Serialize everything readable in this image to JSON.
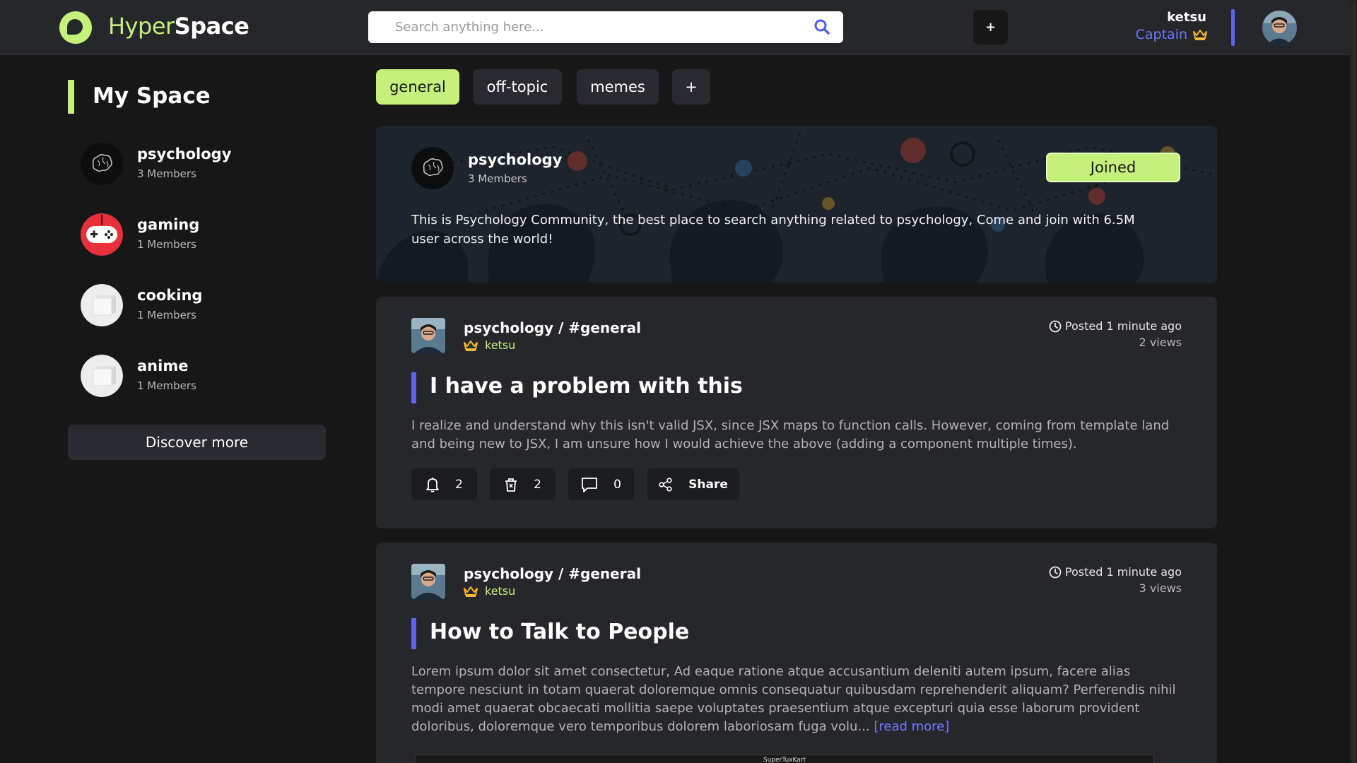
{
  "brand": {
    "part1": "Hyper",
    "part2": "Space"
  },
  "search": {
    "placeholder": "Search anything here..."
  },
  "topbar": {
    "create_label": "+"
  },
  "user": {
    "name": "ketsu",
    "role": "Captain"
  },
  "sidebar": {
    "title": "My Space",
    "items": [
      {
        "name": "psychology",
        "members": "3 Members"
      },
      {
        "name": "gaming",
        "members": "1 Members"
      },
      {
        "name": "cooking",
        "members": "1 Members"
      },
      {
        "name": "anime",
        "members": "1 Members"
      }
    ],
    "discover_label": "Discover more"
  },
  "tabs": [
    {
      "label": "general",
      "active": true
    },
    {
      "label": "off-topic",
      "active": false
    },
    {
      "label": "memes",
      "active": false
    },
    {
      "label": "+",
      "active": false
    }
  ],
  "community": {
    "name": "psychology",
    "members": "3 Members",
    "joined_label": "Joined",
    "description": "This is Psychology Community, the best place to search anything related to psychology, Come and join with 6.5M user across the world!"
  },
  "posts": [
    {
      "path": "psychology / #general",
      "author": "ketsu",
      "posted": "Posted 1 minute ago",
      "views": "2 views",
      "title": "I have a problem with this",
      "body": "I realize and understand why this isn't valid JSX, since JSX maps to function calls. However, coming from template land and being new to JSX, I am unsure how I would achieve the above (adding a component multiple times).",
      "actions": {
        "notify": "2",
        "delete": "2",
        "comments": "0",
        "share": "Share"
      }
    },
    {
      "path": "psychology / #general",
      "author": "ketsu",
      "posted": "Posted 1 minute ago",
      "views": "3 views",
      "title": "How to Talk to People",
      "body": "Lorem ipsum dolor sit amet consectetur, Ad eaque ratione atque accusantium deleniti autem ipsum, facere alias tempore nesciunt in totam quaerat doloremque omnis consequatur quibusdam reprehenderit aliquam? Perferendis nihil modi amet quaerat obcaecati mollitia saepe voluptates praesentium atque excepturi quia esse laborum provident doloribus, doloremque vero temporibus dolorem laboriosam fuga volu...",
      "read_more": "[read more]",
      "image_caption": "SuperTuxKart"
    }
  ],
  "colors": {
    "accent_green": "#c5f07b",
    "accent_blue": "#5b63f5",
    "link_blue": "#6e7bff",
    "background": "#171717",
    "card": "#26272b",
    "crown": "#f5b82e",
    "gaming_red": "#e8303a"
  },
  "icons": {
    "logo": "hyperspace-logo-icon",
    "search": "search-icon",
    "crown": "crown-icon",
    "clock": "clock-icon",
    "bell": "bell-icon",
    "trash": "trash-icon",
    "comment": "comment-icon",
    "share": "share-icon"
  }
}
